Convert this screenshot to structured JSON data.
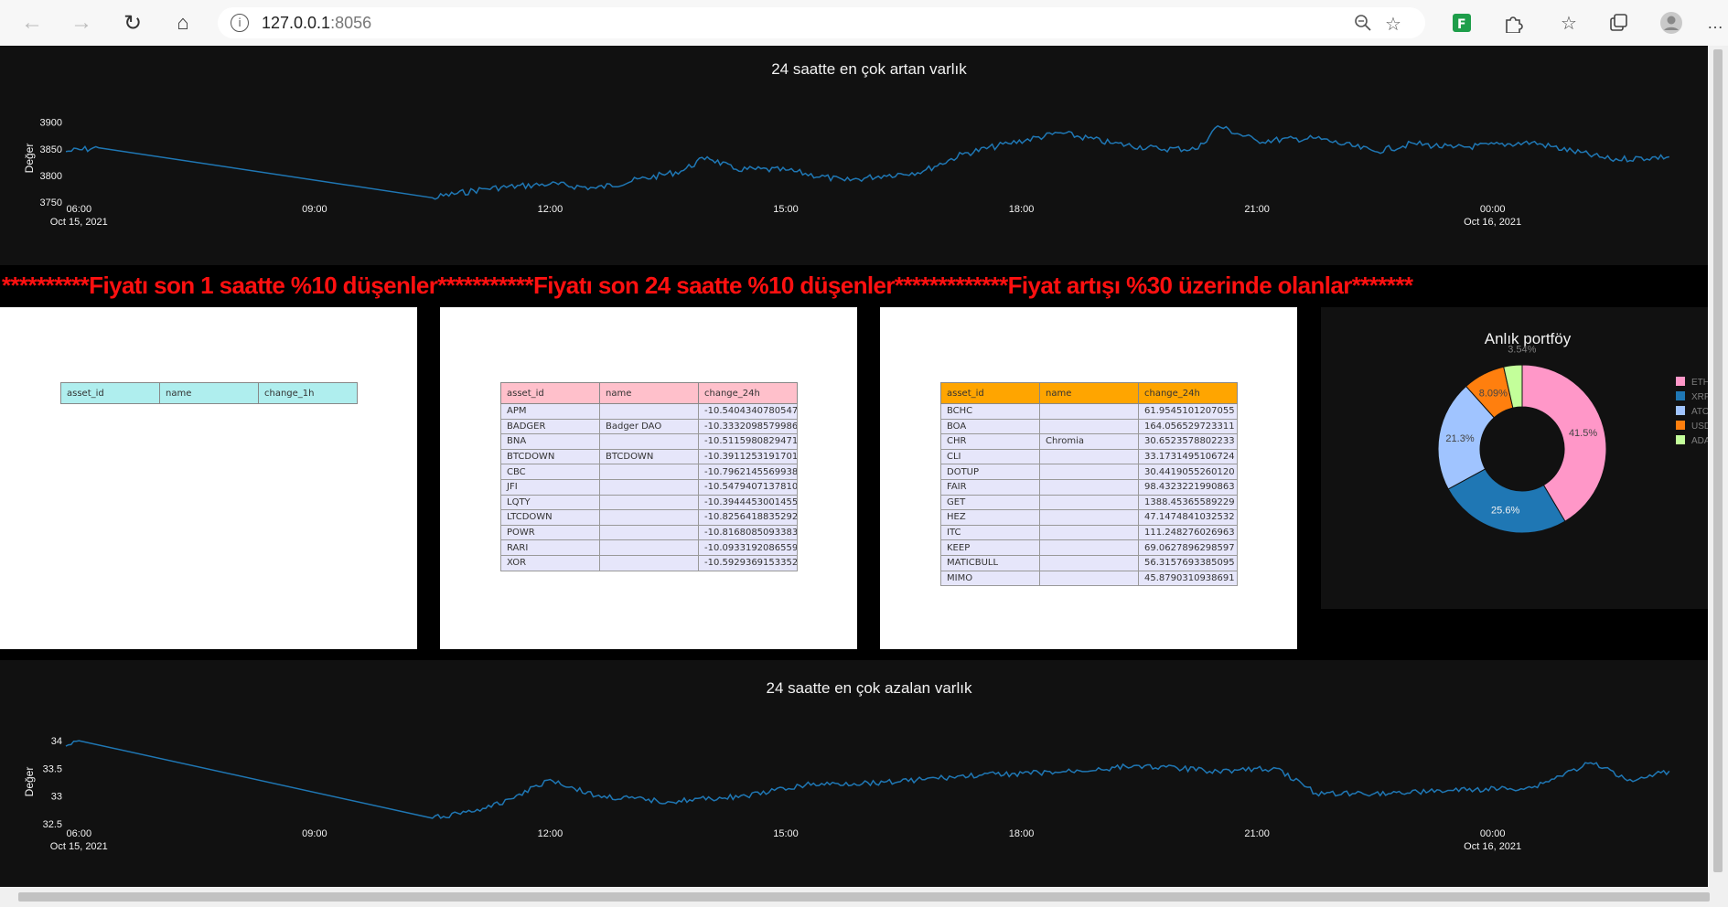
{
  "browser": {
    "url_host": "127.0.0.1",
    "url_port": ":8056",
    "icons": [
      "back-icon",
      "forward-icon",
      "refresh-icon",
      "home-icon",
      "info-icon",
      "zoom-icon",
      "add-favorite-icon",
      "extension-icon",
      "extensions-icon",
      "favorites-icon",
      "collections-icon",
      "profile-icon",
      "more-icon"
    ]
  },
  "colors": {
    "line": "#1f77b4",
    "panel_bg": "#111111",
    "header_text": "#ff1010"
  },
  "top_chart": {
    "title": "24 saatte en çok artan varlık",
    "ylabel": "Değer",
    "yticks": [
      "3900",
      "3850",
      "3800",
      "3750"
    ],
    "xticks": [
      "06:00",
      "09:00",
      "12:00",
      "15:00",
      "18:00",
      "21:00",
      "00:00"
    ],
    "date1": "Oct 15, 2021",
    "date2": "Oct 16, 2021"
  },
  "bottom_chart": {
    "title": "24 saatte en çok azalan varlık",
    "ylabel": "Değer",
    "yticks": [
      "34",
      "33.5",
      "33",
      "32.5"
    ],
    "xticks": [
      "06:00",
      "09:00",
      "12:00",
      "15:00",
      "18:00",
      "21:00",
      "00:00"
    ],
    "date1": "Oct 15, 2021",
    "date2": "Oct 16, 2021"
  },
  "chart_data": [
    {
      "type": "line",
      "title": "24 saatte en çok artan varlık",
      "xlabel": "",
      "ylabel": "Değer",
      "x_range": [
        "2021-10-15 05:50",
        "2021-10-16 02:20"
      ],
      "ylim": [
        3750,
        3920
      ],
      "series": [
        {
          "x": [
            "2021-10-15 05:50",
            "2021-10-15 06:15",
            "2021-10-15 10:30",
            "2021-10-15 11:10",
            "2021-10-15 12:00",
            "2021-10-15 12:35",
            "2021-10-15 13:40",
            "2021-10-15 14:00",
            "2021-10-15 14:20",
            "2021-10-15 15:00",
            "2021-10-15 15:45",
            "2021-10-15 16:15",
            "2021-10-15 16:45",
            "2021-10-15 17:15",
            "2021-10-15 17:50",
            "2021-10-15 18:30",
            "2021-10-15 19:10",
            "2021-10-15 19:45",
            "2021-10-15 20:15",
            "2021-10-15 20:30",
            "2021-10-15 21:00",
            "2021-10-15 21:45",
            "2021-10-15 22:30",
            "2021-10-15 23:00",
            "2021-10-15 23:30",
            "2021-10-16 00:30",
            "2021-10-16 01:30",
            "2021-10-16 02:15"
          ],
          "values": [
            3845,
            3852,
            3758,
            3775,
            3784,
            3776,
            3808,
            3835,
            3812,
            3810,
            3790,
            3800,
            3808,
            3840,
            3860,
            3880,
            3860,
            3850,
            3850,
            3893,
            3865,
            3870,
            3845,
            3860,
            3852,
            3862,
            3830,
            3835
          ]
        }
      ]
    },
    {
      "type": "line",
      "title": "24 saatte en çok azalan varlık",
      "xlabel": "",
      "ylabel": "Değer",
      "x_range": [
        "2021-10-15 05:50",
        "2021-10-16 02:20"
      ],
      "ylim": [
        32.5,
        34.1
      ],
      "series": [
        {
          "x": [
            "2021-10-15 05:50",
            "2021-10-15 06:00",
            "2021-10-15 10:30",
            "2021-10-15 11:15",
            "2021-10-15 12:00",
            "2021-10-15 12:35",
            "2021-10-15 13:30",
            "2021-10-15 14:30",
            "2021-10-15 15:15",
            "2021-10-15 16:15",
            "2021-10-15 17:30",
            "2021-10-15 18:30",
            "2021-10-15 19:30",
            "2021-10-15 20:30",
            "2021-10-15 21:15",
            "2021-10-15 21:45",
            "2021-10-15 22:30",
            "2021-10-15 23:30",
            "2021-10-16 00:30",
            "2021-10-16 01:15",
            "2021-10-16 01:45",
            "2021-10-16 02:15"
          ],
          "values": [
            33.9,
            34.0,
            32.6,
            32.8,
            33.3,
            33.0,
            32.9,
            33.0,
            33.2,
            33.25,
            33.38,
            33.43,
            33.55,
            33.45,
            33.5,
            33.05,
            33.05,
            33.1,
            33.15,
            33.6,
            33.3,
            33.45
          ]
        }
      ]
    },
    {
      "type": "pie",
      "title": "Anlık portföy",
      "categories": [
        "ETH",
        "XRP",
        "ATOM",
        "USDT",
        "ADA"
      ],
      "values": [
        41.5,
        25.6,
        21.3,
        8.09,
        3.54
      ],
      "labels": [
        "41.5%",
        "25.6%",
        "21.3%",
        "8.09%",
        "3.54%"
      ],
      "colors": [
        "#ff97c8",
        "#1f77b4",
        "#a0c4ff",
        "#ff7f0e",
        "#c3ff9a"
      ],
      "legend": "right"
    }
  ],
  "header_text": "**********Fiyatı son 1 saatte %10 düşenler***********Fiyatı son 24 saatte %10 düşenler*************Fiyat artışı %30 üzerinde olanlar*******",
  "table1": {
    "header_color": "#afeeee",
    "headers": [
      "asset_id",
      "name",
      "change_1h"
    ],
    "rows": []
  },
  "table2": {
    "header_color": "#ffc0cb",
    "headers": [
      "asset_id",
      "name",
      "change_24h"
    ],
    "rows": [
      [
        "APM",
        "",
        "-10.5404340780547"
      ],
      [
        "BADGER",
        "Badger DAO",
        "-10.3332098579986"
      ],
      [
        "BNA",
        "",
        "-10.5115980829471"
      ],
      [
        "BTCDOWN",
        "BTCDOWN",
        "-10.3911253191701"
      ],
      [
        "CBC",
        "",
        "-10.7962145569938"
      ],
      [
        "JFI",
        "",
        "-10.5479407137810"
      ],
      [
        "LQTY",
        "",
        "-10.3944453001455"
      ],
      [
        "LTCDOWN",
        "",
        "-10.8256418835292"
      ],
      [
        "POWR",
        "",
        "-10.8168085093383"
      ],
      [
        "RARI",
        "",
        "-10.0933192086559"
      ],
      [
        "XOR",
        "",
        "-10.5929369153352"
      ]
    ]
  },
  "table3": {
    "header_color": "#ffa500",
    "headers": [
      "asset_id",
      "name",
      "change_24h"
    ],
    "rows": [
      [
        "BCHC",
        "",
        "61.9545101207055"
      ],
      [
        "BOA",
        "",
        "164.056529723311"
      ],
      [
        "CHR",
        "Chromia",
        "30.6523578802233"
      ],
      [
        "CLI",
        "",
        "33.1731495106724"
      ],
      [
        "DOTUP",
        "",
        "30.4419055260120"
      ],
      [
        "FAIR",
        "",
        "98.4323221990863"
      ],
      [
        "GET",
        "",
        "1388.45365589229"
      ],
      [
        "HEZ",
        "",
        "47.1474841032532"
      ],
      [
        "ITC",
        "",
        "111.248276026963"
      ],
      [
        "KEEP",
        "",
        "69.0627896298597"
      ],
      [
        "MATICBULL",
        "",
        "56.3157693385095"
      ],
      [
        "MIMO",
        "",
        "45.8790310938691"
      ]
    ]
  }
}
